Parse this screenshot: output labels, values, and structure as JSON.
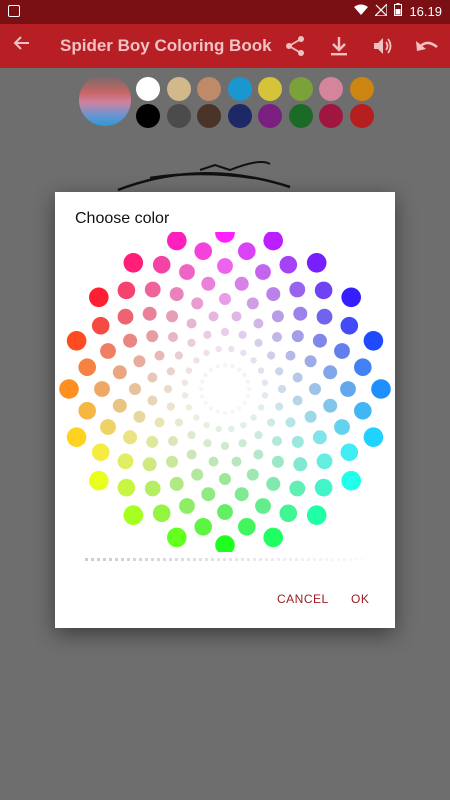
{
  "status_bar": {
    "time": "16.19"
  },
  "app_bar": {
    "title": "Spider Boy Coloring Book",
    "icons": [
      "back-arrow-icon",
      "share-icon",
      "download-icon",
      "volume-icon",
      "undo-icon"
    ]
  },
  "palette": {
    "row1": [
      "#ffffff",
      "#d2b98c",
      "#bf8a69",
      "#1b97cf",
      "#d5c43a",
      "#7aa13a",
      "#d4849b",
      "#cc8510"
    ],
    "row2": [
      "#000000",
      "#4b4b4b",
      "#4a3428",
      "#1d2866",
      "#7a1f80",
      "#1b6a27",
      "#a0163e",
      "#b51f1f"
    ]
  },
  "dialog": {
    "title": "Choose color",
    "cancel_label": "CANCEL",
    "ok_label": "OK"
  }
}
